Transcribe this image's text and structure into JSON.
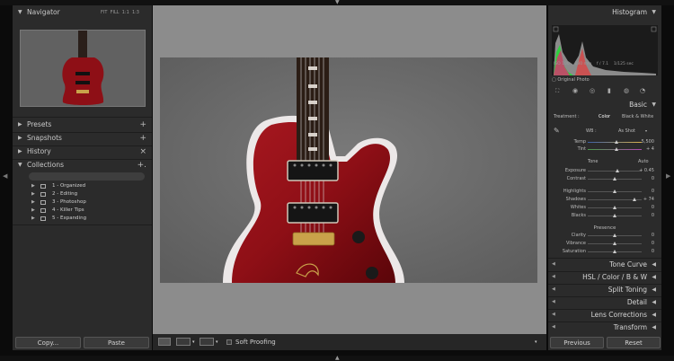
{
  "left": {
    "navigator": {
      "title": "Navigator",
      "opts": [
        "FIT",
        "FILL",
        "1:1",
        "1:3"
      ]
    },
    "panels": [
      {
        "name": "Presets",
        "action": "+"
      },
      {
        "name": "Snapshots",
        "action": "+"
      },
      {
        "name": "History",
        "action": "×"
      }
    ],
    "collections": {
      "title": "Collections",
      "action": "+.",
      "items": [
        "1 - Organized",
        "2 - Editing",
        "3 - Photoshop",
        "4 - Killer Tips",
        "5 - Expanding"
      ]
    },
    "copy_label": "Copy...",
    "paste_label": "Paste"
  },
  "toolbar": {
    "soft_proofing": "Soft Proofing"
  },
  "right": {
    "histogram": {
      "title": "Histogram",
      "meta": [
        "ISO 100",
        "180 mm",
        "f / 7.1",
        "1/125 sec"
      ],
      "original_photo": "Original Photo"
    },
    "basic": {
      "title": "Basic",
      "treatment_label": "Treatment :",
      "treatment_options": [
        "Color",
        "Black & White"
      ],
      "wb_label": "WB :",
      "wb_value": "As Shot",
      "tone_label": "Tone",
      "tone_auto": "Auto",
      "presence_label": "Presence",
      "sliders": [
        {
          "name": "Temp",
          "value": "5,500",
          "pos": 0.52
        },
        {
          "name": "Tint",
          "value": "+ 4",
          "pos": 0.52
        },
        {
          "name": "Exposure",
          "value": "+ 0.45",
          "pos": 0.55
        },
        {
          "name": "Contrast",
          "value": "0",
          "pos": 0.5
        },
        {
          "name": "Highlights",
          "value": "0",
          "pos": 0.5
        },
        {
          "name": "Shadows",
          "value": "+ 74",
          "pos": 0.87
        },
        {
          "name": "Whites",
          "value": "0",
          "pos": 0.5
        },
        {
          "name": "Blacks",
          "value": "0",
          "pos": 0.5
        },
        {
          "name": "Clarity",
          "value": "0",
          "pos": 0.5
        },
        {
          "name": "Vibrance",
          "value": "0",
          "pos": 0.5
        },
        {
          "name": "Saturation",
          "value": "0",
          "pos": 0.5
        }
      ]
    },
    "sections": [
      "Tone Curve",
      "HSL / Color / B & W",
      "Split Toning",
      "Detail",
      "Lens Corrections",
      "Transform"
    ],
    "previous_label": "Previous",
    "reset_label": "Reset"
  },
  "colors": {
    "panel": "#2b2b2b",
    "center_bg": "#8c8c8c",
    "guitar_red": "#8e0f16"
  }
}
